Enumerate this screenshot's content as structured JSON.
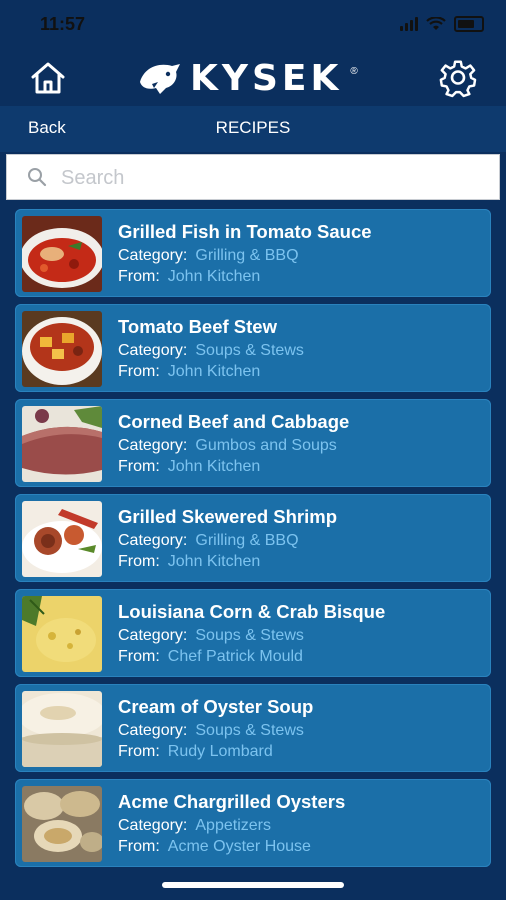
{
  "status_bar": {
    "time": "11:57"
  },
  "header": {
    "logo_text": "KYSEK",
    "logo_mark": "®"
  },
  "nav": {
    "back_label": "Back",
    "title": "RECIPES"
  },
  "search": {
    "placeholder": "Search"
  },
  "recipes": [
    {
      "title": "Grilled Fish in Tomato Sauce",
      "category_label": "Category:",
      "category": "Grilling & BBQ",
      "from_label": "From:",
      "from": "John Kitchen"
    },
    {
      "title": "Tomato Beef Stew",
      "category_label": "Category:",
      "category": "Soups & Stews",
      "from_label": "From:",
      "from": "John Kitchen"
    },
    {
      "title": "Corned Beef and Cabbage",
      "category_label": "Category:",
      "category": "Gumbos and Soups",
      "from_label": "From:",
      "from": "John Kitchen"
    },
    {
      "title": "Grilled Skewered Shrimp",
      "category_label": "Category:",
      "category": "Grilling & BBQ",
      "from_label": "From:",
      "from": "John Kitchen"
    },
    {
      "title": "Louisiana Corn & Crab Bisque",
      "category_label": "Category:",
      "category": "Soups & Stews",
      "from_label": "From:",
      "from": "Chef Patrick Mould"
    },
    {
      "title": "Cream of Oyster Soup",
      "category_label": "Category:",
      "category": "Soups & Stews",
      "from_label": "From:",
      "from": "Rudy Lombard"
    },
    {
      "title": "Acme Chargrilled Oysters",
      "category_label": "Category:",
      "category": "Appetizers",
      "from_label": "From:",
      "from": "Acme Oyster House"
    }
  ],
  "colors": {
    "header_bg": "#0b2f5e",
    "nav_bg": "#0e3a6e",
    "card_bg": "#1b6fa8",
    "meta_value": "#7cc3ef"
  }
}
